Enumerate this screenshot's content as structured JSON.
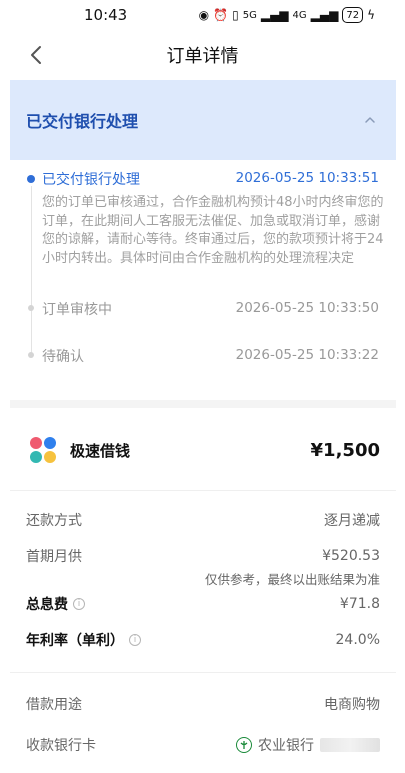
{
  "status_bar": {
    "time": "10:43",
    "network_5g": "5G",
    "network_4g": "4G",
    "battery": "72"
  },
  "nav": {
    "title": "订单详情"
  },
  "order_status": {
    "title": "已交付银行处理"
  },
  "timeline": [
    {
      "label": "已交付银行处理",
      "time": "2026-05-25 10:33:51",
      "active": true,
      "desc": "您的订单已审核通过，合作金融机构预计48小时内终审您的订单，在此期间人工客服无法催促、加急或取消订单，感谢您的谅解，请耐心等待。终审通过后，您的款项预计将于24小时内转出。具体时间由合作金融机构的处理流程决定"
    },
    {
      "label": "订单审核中",
      "time": "2026-05-25 10:33:50",
      "active": false
    },
    {
      "label": "待确认",
      "time": "2026-05-25 10:33:22",
      "active": false
    }
  ],
  "product": {
    "name": "极速借钱",
    "amount": "¥1,500",
    "logo_colors": [
      "#ef5a6f",
      "#2f80ed",
      "#32b8b2",
      "#f6c23e"
    ]
  },
  "details": {
    "repayment_label": "还款方式",
    "repayment_value": "逐月递减",
    "first_payment_label": "首期月供",
    "first_payment_value": "¥520.53",
    "first_payment_note": "仅供参考，最终以出账结果为准",
    "total_interest_label": "总息费",
    "total_interest_value": "¥71.8",
    "annual_rate_label": "年利率（单利）",
    "annual_rate_value": "24.0%",
    "purpose_label": "借款用途",
    "purpose_value": "电商购物",
    "bank_card_label": "收款银行卡",
    "bank_card_value": "农业银行"
  },
  "colors": {
    "accent": "#2f6ed7",
    "header_bg": "#dde9fc",
    "header_text": "#1f4fae",
    "bank_green": "#1a8a3a"
  }
}
